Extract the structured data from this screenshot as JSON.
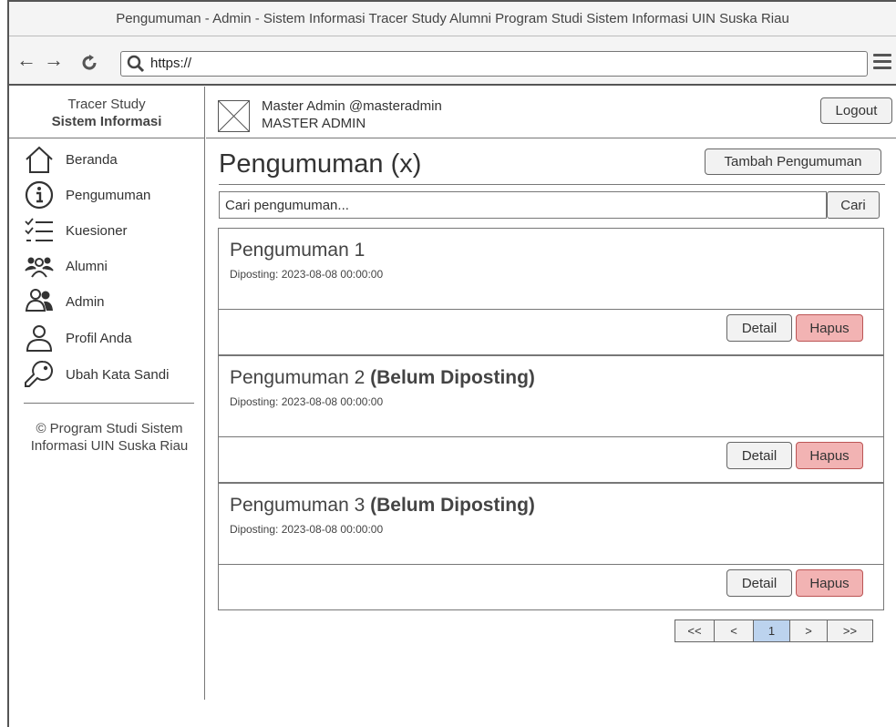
{
  "window": {
    "title": "Pengumuman - Admin - Sistem Informasi Tracer Study Alumni Program Studi Sistem Informasi UIN Suska Riau"
  },
  "browser": {
    "url": "https://",
    "back_icon": "back-arrow-icon",
    "forward_icon": "forward-arrow-icon",
    "reload_icon": "reload-icon"
  },
  "sidebar": {
    "brand_line1": "Tracer Study",
    "brand_line2": "Sistem Informasi",
    "items": [
      {
        "label": "Beranda",
        "icon": "home-icon"
      },
      {
        "label": "Pengumuman",
        "icon": "info-icon"
      },
      {
        "label": "Kuesioner",
        "icon": "checklist-icon"
      },
      {
        "label": "Alumni",
        "icon": "group-icon"
      },
      {
        "label": "Admin",
        "icon": "admin-icon"
      },
      {
        "label": "Profil Anda",
        "icon": "user-icon"
      },
      {
        "label": "Ubah Kata Sandi",
        "icon": "key-icon"
      }
    ],
    "copyright": "© Program Studi Sistem Informasi UIN Suska Riau"
  },
  "header": {
    "user_name": "Master Admin @masteradmin",
    "user_role": "MASTER ADMIN",
    "logout_label": "Logout"
  },
  "main": {
    "title": "Pengumuman (x)",
    "add_button": "Tambah Pengumuman",
    "search_placeholder": "Cari pengumuman...",
    "search_button": "Cari",
    "announcements": [
      {
        "title": "Pengumuman 1",
        "status": "",
        "date": "Diposting: 2023-08-08 00:00:00",
        "detail": "Detail",
        "delete": "Hapus"
      },
      {
        "title": "Pengumuman 2",
        "status": "(Belum Diposting)",
        "date": "Diposting: 2023-08-08 00:00:00",
        "detail": "Detail",
        "delete": "Hapus"
      },
      {
        "title": "Pengumuman 3",
        "status": "(Belum Diposting)",
        "date": "Diposting: 2023-08-08 00:00:00",
        "detail": "Detail",
        "delete": "Hapus"
      }
    ],
    "pagination": {
      "first": "<<",
      "prev": "<",
      "current": "1",
      "next": ">",
      "last": ">>"
    }
  },
  "colors": {
    "accent_page": "#bcd3ee",
    "danger": "#f2b3b3",
    "border": "#777777"
  }
}
